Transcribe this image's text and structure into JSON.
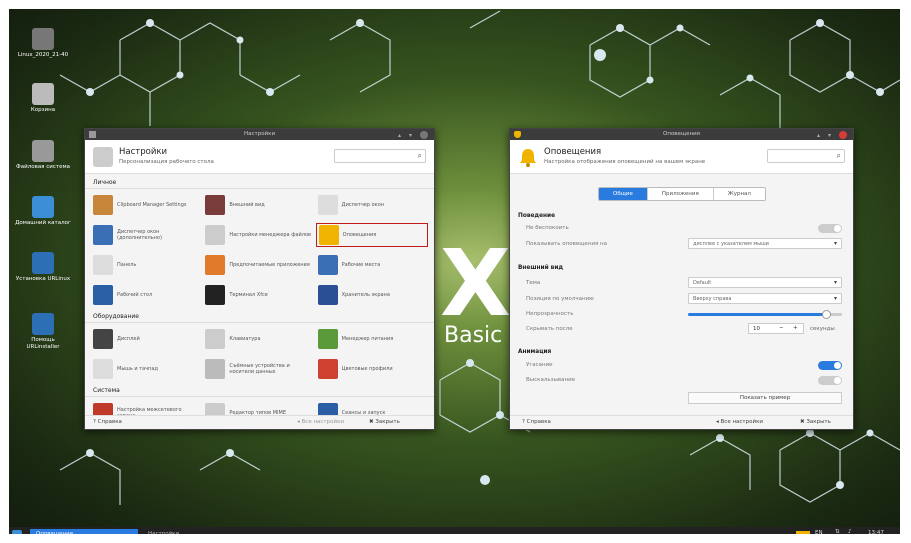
{
  "desktop": {
    "logo_letter": "X",
    "logo_word": "Basic",
    "icons": [
      {
        "label": "Linux_2020_21-40",
        "color": "#777"
      },
      {
        "label": "Корзина",
        "color": "#bbb"
      },
      {
        "label": "Файловая система",
        "color": "#999"
      },
      {
        "label": "Домашний каталог",
        "color": "#3a8fd6"
      },
      {
        "label": "Установка URLinux",
        "color": "#2c6fb5"
      },
      {
        "label": "Помощь URLinstaller",
        "color": "#2c6fb5"
      }
    ]
  },
  "settings_window": {
    "title": "Настройки",
    "header_title": "Настройки",
    "header_subtitle": "Персонализация рабочего стола",
    "sections": [
      {
        "name": "Личное",
        "items": [
          {
            "label": "Clipboard Manager Settings",
            "color": "#c8863a"
          },
          {
            "label": "Внешний вид",
            "color": "#7a3b3b"
          },
          {
            "label": "Диспетчер окон",
            "color": "#ddd"
          },
          {
            "label": "Диспетчер окон (дополнительно)",
            "color": "#3a6fb5"
          },
          {
            "label": "Настройки менеджера файлов",
            "color": "#ccc"
          },
          {
            "label": "Оповещения",
            "color": "#f0b400",
            "selected": true
          },
          {
            "label": "Панель",
            "color": "#ddd"
          },
          {
            "label": "Предпочитаемые приложения",
            "color": "#e07b2a"
          },
          {
            "label": "Рабочие места",
            "color": "#3a6fb5"
          },
          {
            "label": "Рабочий стол",
            "color": "#2a5fa5"
          },
          {
            "label": "Терминал Xfce",
            "color": "#222"
          },
          {
            "label": "Хранитель экрана",
            "color": "#2a4f95"
          }
        ]
      },
      {
        "name": "Оборудование",
        "items": [
          {
            "label": "Дисплей",
            "color": "#444"
          },
          {
            "label": "Клавиатура",
            "color": "#ccc"
          },
          {
            "label": "Менеджер питания",
            "color": "#5a9a3a"
          },
          {
            "label": "Мышь и тачпад",
            "color": "#ddd"
          },
          {
            "label": "Съёмные устройства и носители данных",
            "color": "#bbb"
          },
          {
            "label": "Цветовые профили",
            "color": "#d04030"
          }
        ]
      },
      {
        "name": "Система",
        "items": [
          {
            "label": "Настройка межсетевого экрана",
            "color": "#c03a2a"
          },
          {
            "label": "Редактор типов MIME",
            "color": "#ccc"
          },
          {
            "label": "Сеансы и запуск",
            "color": "#2a5fa5"
          }
        ]
      }
    ],
    "footer": {
      "help": "Справка",
      "all_settings": "Все настройки",
      "close": "Закрыть"
    }
  },
  "notif_window": {
    "title": "Оповещения",
    "header_title": "Оповещения",
    "header_subtitle": "Настройка отображения оповещений на вашем экране",
    "tabs": [
      "Общие",
      "Приложения",
      "Журнал"
    ],
    "active_tab": 0,
    "behavior": {
      "section": "Поведение",
      "dnd_label": "Не беспокоить",
      "dnd_on": false,
      "show_on_label": "Показывать оповещения на",
      "show_on_value": "дисплее с указателем мыши"
    },
    "appearance": {
      "section": "Внешний вид",
      "theme_label": "Тема",
      "theme_value": "Default",
      "position_label": "Позиция по умолчанию",
      "position_value": "Вверху справа",
      "opacity_label": "Непрозрачность",
      "opacity_value": 0.9,
      "hide_after_label": "Скрывать после",
      "hide_after_value": "10",
      "hide_after_unit": "секунды"
    },
    "animation": {
      "section": "Анимация",
      "fade_label": "Угасание",
      "fade_on": true,
      "slide_label": "Выскальзывание",
      "slide_on": false
    },
    "preview_button": "Показать пример",
    "footer": {
      "help": "Справка",
      "all_settings": "Все настройки",
      "close": "Закрыть"
    }
  },
  "taskbar": {
    "items": [
      "Оповещения",
      "Настройки"
    ],
    "lang": "EN",
    "clock": "13:47"
  }
}
